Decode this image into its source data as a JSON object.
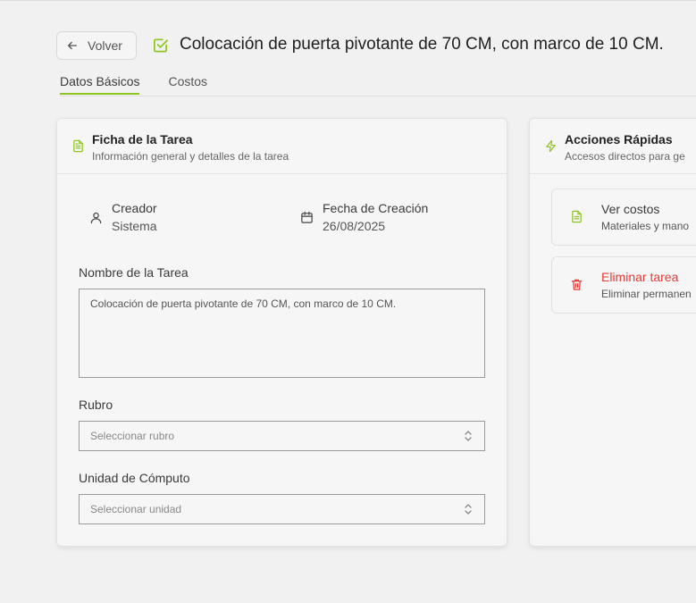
{
  "header": {
    "back_label": "Volver",
    "title": "Colocación de puerta pivotante de 70 CM, con marco de 10 CM."
  },
  "tabs": [
    {
      "label": "Datos Básicos",
      "active": true
    },
    {
      "label": "Costos",
      "active": false
    }
  ],
  "task_card": {
    "title": "Ficha de la Tarea",
    "subtitle": "Información general y detalles de la tarea",
    "creator_label": "Creador",
    "creator_value": "Sistema",
    "date_label": "Fecha de Creación",
    "date_value": "26/08/2025",
    "name_label": "Nombre de la Tarea",
    "name_value": "Colocación de puerta pivotante de 70 CM, con marco de 10 CM.",
    "rubro_label": "Rubro",
    "rubro_placeholder": "Seleccionar rubro",
    "unit_label": "Unidad de Cómputo",
    "unit_placeholder": "Seleccionar unidad"
  },
  "quick_actions": {
    "title": "Acciones Rápidas",
    "subtitle": "Accesos directos para ge",
    "items": [
      {
        "title": "Ver costos",
        "subtitle": "Materiales y mano",
        "icon": "file-text-icon"
      },
      {
        "title": "Eliminar tarea",
        "subtitle": "Eliminar permanen",
        "icon": "trash-icon"
      }
    ]
  },
  "colors": {
    "accent": "#8fc31f",
    "danger": "#e53935",
    "background": "#f1f1f1",
    "card": "#f6f6f6"
  }
}
